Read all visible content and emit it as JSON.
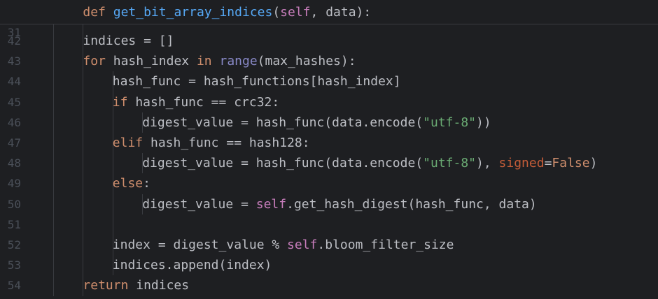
{
  "sticky": {
    "line_no": "31",
    "tokens": [
      {
        "t": "def ",
        "c": "kw"
      },
      {
        "t": "get_bit_array_indices",
        "c": "fn"
      },
      {
        "t": "(",
        "c": "def"
      },
      {
        "t": "self",
        "c": "self"
      },
      {
        "t": ", data):",
        "c": "def"
      }
    ],
    "indent": 2
  },
  "lines": [
    {
      "no": "42",
      "indent": 2,
      "tokens": [
        {
          "t": "indices = []",
          "c": "def"
        }
      ]
    },
    {
      "no": "43",
      "indent": 2,
      "tokens": [
        {
          "t": "for ",
          "c": "kw"
        },
        {
          "t": "hash_index ",
          "c": "def"
        },
        {
          "t": "in ",
          "c": "kw"
        },
        {
          "t": "range",
          "c": "bi"
        },
        {
          "t": "(max_hashes):",
          "c": "def"
        }
      ]
    },
    {
      "no": "44",
      "indent": 3,
      "tokens": [
        {
          "t": "hash_func = hash_functions[hash_index]",
          "c": "def"
        }
      ]
    },
    {
      "no": "45",
      "indent": 3,
      "tokens": [
        {
          "t": "if ",
          "c": "kw"
        },
        {
          "t": "hash_func == crc32:",
          "c": "def"
        }
      ]
    },
    {
      "no": "46",
      "indent": 4,
      "tokens": [
        {
          "t": "digest_value = hash_func(data.encode(",
          "c": "def"
        },
        {
          "t": "\"utf-8\"",
          "c": "str"
        },
        {
          "t": "))",
          "c": "def"
        }
      ]
    },
    {
      "no": "47",
      "indent": 3,
      "tokens": [
        {
          "t": "elif ",
          "c": "kw"
        },
        {
          "t": "hash_func == hash128:",
          "c": "def"
        }
      ]
    },
    {
      "no": "48",
      "indent": 4,
      "tokens": [
        {
          "t": "digest_value = hash_func(data.encode(",
          "c": "def"
        },
        {
          "t": "\"utf-8\"",
          "c": "str"
        },
        {
          "t": "), ",
          "c": "def"
        },
        {
          "t": "signed",
          "c": "named"
        },
        {
          "t": "=",
          "c": "def"
        },
        {
          "t": "False",
          "c": "kw"
        },
        {
          "t": ")",
          "c": "def"
        }
      ]
    },
    {
      "no": "49",
      "indent": 3,
      "tokens": [
        {
          "t": "else",
          "c": "kw"
        },
        {
          "t": ":",
          "c": "def"
        }
      ]
    },
    {
      "no": "50",
      "indent": 4,
      "tokens": [
        {
          "t": "digest_value = ",
          "c": "def"
        },
        {
          "t": "self",
          "c": "self"
        },
        {
          "t": ".get_hash_digest(hash_func, data)",
          "c": "def"
        }
      ]
    },
    {
      "no": "51",
      "indent": 0,
      "tokens": []
    },
    {
      "no": "52",
      "indent": 3,
      "tokens": [
        {
          "t": "index = digest_value % ",
          "c": "def"
        },
        {
          "t": "self",
          "c": "self"
        },
        {
          "t": ".bloom_filter_size",
          "c": "def"
        }
      ]
    },
    {
      "no": "53",
      "indent": 3,
      "tokens": [
        {
          "t": "indices.append(index)",
          "c": "def"
        }
      ]
    },
    {
      "no": "54",
      "indent": 2,
      "tokens": [
        {
          "t": "return ",
          "c": "kw"
        },
        {
          "t": "indices",
          "c": "def"
        }
      ]
    }
  ],
  "colors": {
    "background": "#1e1f22",
    "keyword": "#cf8e6d",
    "function": "#56a8f5",
    "self": "#c77dbb",
    "string": "#6aab73",
    "named_arg": "#c45c38",
    "builtin": "#8888c6",
    "text": "#bcbec4",
    "line_number": "#4b5059"
  }
}
